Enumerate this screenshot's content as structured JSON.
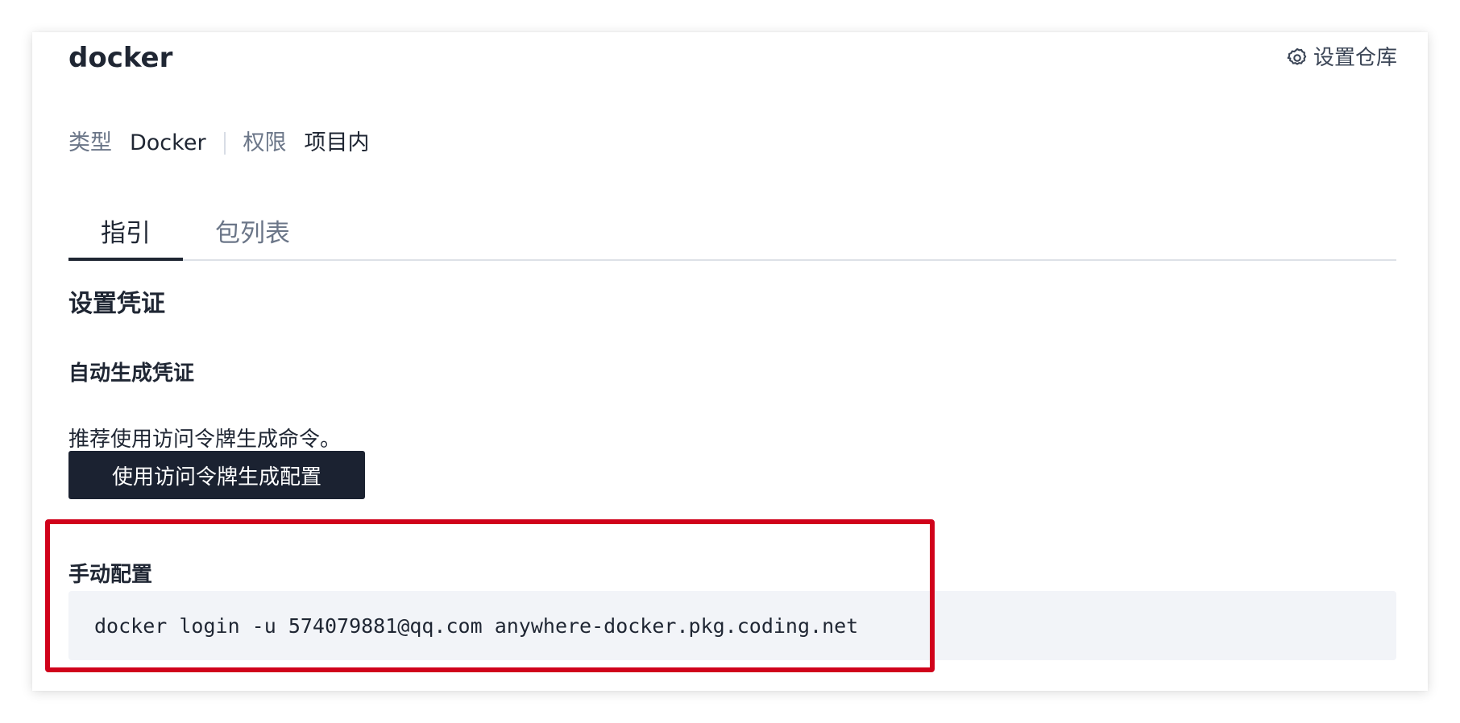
{
  "repo": {
    "title": "docker",
    "settings_label": "设置仓库"
  },
  "meta": {
    "type_label": "类型",
    "type_value": "Docker",
    "permission_label": "权限",
    "permission_value": "项目内"
  },
  "tabs": [
    {
      "label": "指引",
      "active": true
    },
    {
      "label": "包列表",
      "active": false
    }
  ],
  "guide": {
    "section_title": "设置凭证",
    "auto_title": "自动生成凭证",
    "auto_desc": "推荐使用访问令牌生成命令。",
    "generate_button": "使用访问令牌生成配置",
    "manual_title": "手动配置",
    "command": "docker login -u 574079881@qq.com anywhere-docker.pkg.coding.net"
  },
  "colors": {
    "primary_button": "#1b2231",
    "highlight_border": "#d0021b",
    "code_background": "#f2f4f8"
  },
  "icons": {
    "settings": "gear-icon"
  }
}
